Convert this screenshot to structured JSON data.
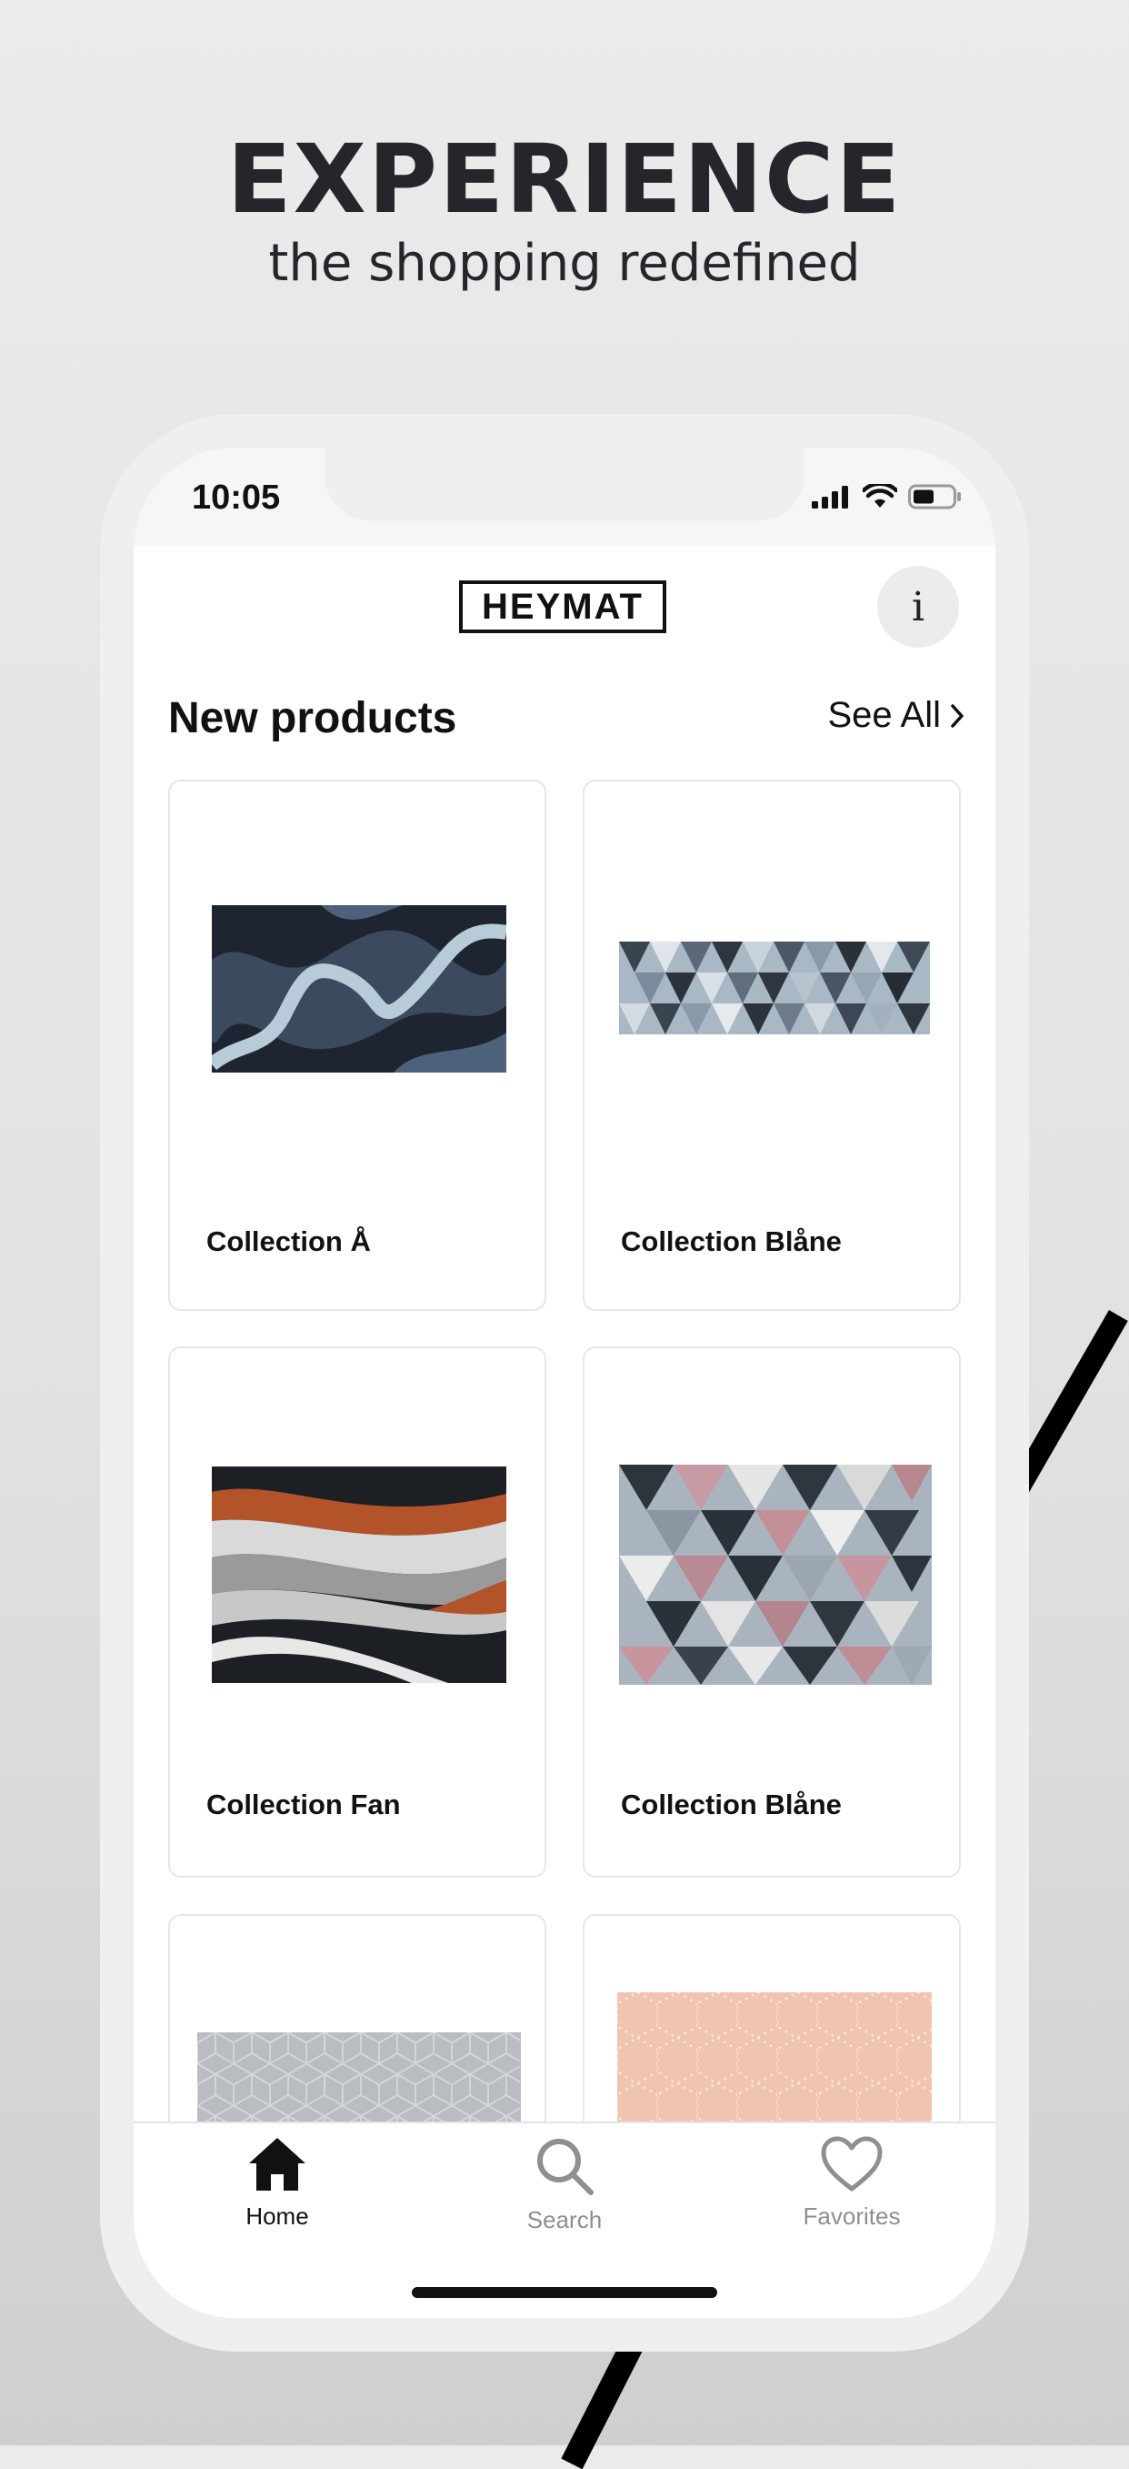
{
  "promo": {
    "headline": "EXPERIENCE",
    "subheadline": "the shopping redefined"
  },
  "status_bar": {
    "time": "10:05"
  },
  "header": {
    "logo_text": "HEYMAT",
    "info_label": "i"
  },
  "section": {
    "title": "New products",
    "see_all_label": "See All"
  },
  "products": [
    {
      "name": "Collection Å",
      "pattern": "waves"
    },
    {
      "name": "Collection Blåne",
      "pattern": "triangles"
    },
    {
      "name": "Collection Fan",
      "pattern": "waves"
    },
    {
      "name": "Collection Blåne",
      "pattern": "triangles"
    },
    {
      "name": "",
      "pattern": "hexagons"
    },
    {
      "name": "",
      "pattern": "hexagons"
    }
  ],
  "tabbar": {
    "items": [
      {
        "label": "Home",
        "icon": "home-icon",
        "active": true
      },
      {
        "label": "Search",
        "icon": "search-icon",
        "active": false
      },
      {
        "label": "Favorites",
        "icon": "heart-icon",
        "active": false
      }
    ],
    "active_color": "#111111",
    "inactive_color": "#8e8e93"
  }
}
